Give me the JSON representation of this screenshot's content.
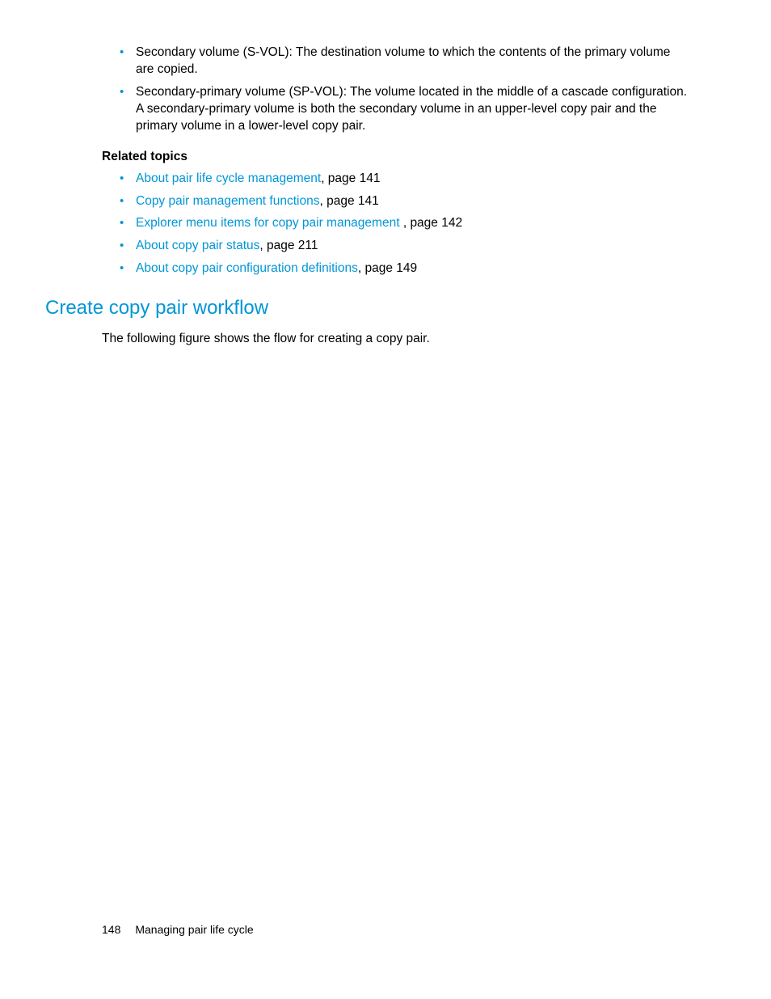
{
  "body": {
    "bullets": [
      "Secondary volume (S-VOL): The destination volume to which the contents of the primary volume are copied.",
      "Secondary-primary volume (SP-VOL): The volume located in the middle of a cascade configuration. A secondary-primary volume is both the secondary volume in an upper-level copy pair and the primary volume in a lower-level copy pair."
    ]
  },
  "related": {
    "heading": "Related topics",
    "items": [
      {
        "link": "About pair life cycle management",
        "suffix": ", page 141"
      },
      {
        "link": "Copy pair management functions",
        "suffix": ", page 141"
      },
      {
        "link": "Explorer menu items for copy pair management ",
        "suffix": ", page 142"
      },
      {
        "link": "About copy pair status",
        "suffix": ", page 211"
      },
      {
        "link": "About copy pair configuration definitions",
        "suffix": ", page 149"
      }
    ]
  },
  "section": {
    "heading": "Create copy pair workflow",
    "para": "The following figure shows the flow for creating a copy pair."
  },
  "footer": {
    "page": "148",
    "title": "Managing pair life cycle"
  }
}
